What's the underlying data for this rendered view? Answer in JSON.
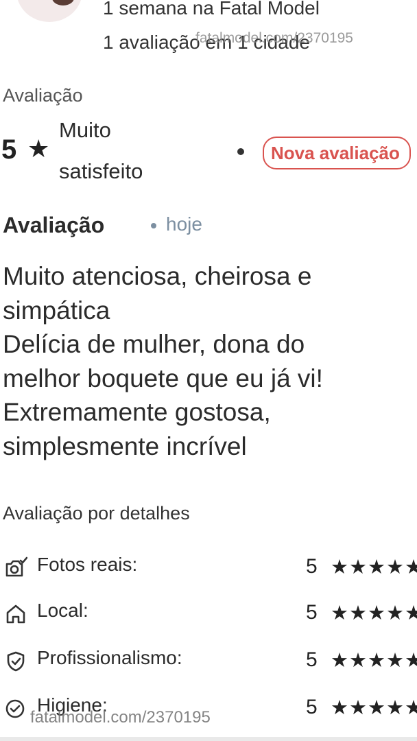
{
  "header": {
    "time_on_site": "1 semana na Fatal Model",
    "reviews_count": "1 avaliação em 1 cidade",
    "watermark": "fatalmodel.com/2370195"
  },
  "summary": {
    "section_label": "Avaliação",
    "score": "5",
    "star_glyph": "★",
    "satisfaction_line1": "Muito",
    "satisfaction_line2": "satisfeito",
    "badge": "Nova avaliação",
    "badge_color": "#d9534f"
  },
  "review": {
    "title": "Avaliação",
    "date": "hoje",
    "lines": [
      "Muito atenciosa, cheirosa e",
      "simpática",
      "Delícia de mulher, dona do",
      "melhor boquete que eu já vi!",
      "Extremamente gostosa,",
      "simplesmente incrível"
    ]
  },
  "details": {
    "title": "Avaliação por detalhes",
    "rows": [
      {
        "label": "Fotos reais:",
        "value": "5",
        "stars": "★★★★★",
        "icon": "camera-check-icon"
      },
      {
        "label": "Local:",
        "value": "5",
        "stars": "★★★★★",
        "icon": "home-icon"
      },
      {
        "label": "Profissionalismo:",
        "value": "5",
        "stars": "★★★★★",
        "icon": "shield-check-icon"
      },
      {
        "label": "Higiene:",
        "value": "5",
        "stars": "★★★★★",
        "icon": "check-circle-icon"
      }
    ]
  },
  "footer": {
    "watermark": "fatalmodel.com/2370195"
  }
}
